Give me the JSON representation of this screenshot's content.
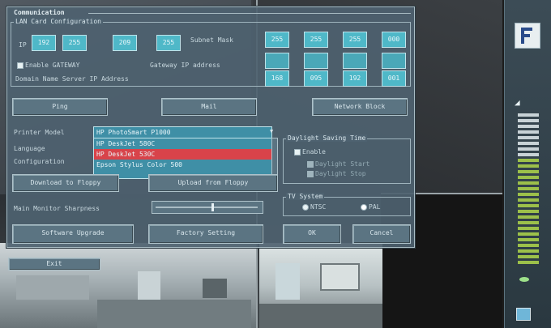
{
  "dialog": {
    "title": "Communication",
    "lan_group": "LAN Card Configuration",
    "ip_label": "IP",
    "ip": [
      "192",
      "255",
      "209",
      "255"
    ],
    "subnet_label": "Subnet Mask",
    "subnet": [
      "255",
      "255",
      "255",
      "000"
    ],
    "enable_gateway_label": "Enable GATEWAY",
    "gateway_label": "Gateway IP address",
    "gateway": [
      "",
      "",
      "",
      ""
    ],
    "dns_label": "Domain Name Server IP  Address",
    "dns": [
      "168",
      "095",
      "192",
      "001"
    ],
    "ping_button": "Ping",
    "mail_button": "Mail",
    "network_block_button": "Network Block",
    "printer_model_label": "Printer Model",
    "printer_selected": "HP PhotoSmart P1000",
    "printer_options": [
      "HP DeskJet 580C",
      "HP DeskJet 530C",
      "Epson Stylus Color 500"
    ],
    "printer_highlighted_index": 1,
    "language_label": "Language",
    "configuration_label": "Configuration",
    "download_button": "Download to Floppy",
    "upload_button": "Upload from Floppy",
    "daylight_group": "Daylight Saving Time",
    "daylight_enable_label": "Enable",
    "daylight_sub1": "Daylight Start",
    "daylight_sub2": "Daylight Stop",
    "tv_group": "TV System",
    "tv_ntsc": "NTSC",
    "tv_pal": "PAL",
    "sharpness_label": "Main Monitor Sharpness",
    "sharpness_level": 0.55,
    "software_upgrade_button": "Software Upgrade",
    "factory_setting_button": "Factory Setting",
    "ok_button": "OK",
    "cancel_button": "Cancel",
    "exit_label": "Exit"
  }
}
